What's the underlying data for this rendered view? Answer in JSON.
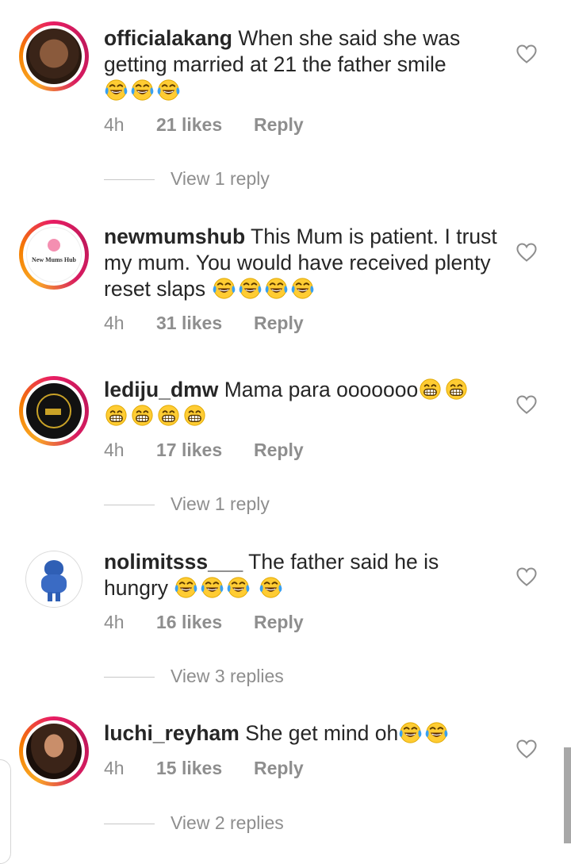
{
  "comments": [
    {
      "username": "officialakang",
      "text": "When she said she was getting married at 21 the father smile",
      "emoji_count": 3,
      "time": "4h",
      "likes": "21 likes",
      "reply": "Reply",
      "view_replies": "View 1 reply"
    },
    {
      "username": "newmumshub",
      "avatar_label": "New Mums Hub",
      "text": "This Mum is patient. I trust my mum.  You would have received plenty reset slaps",
      "emoji_count": 4,
      "time": "4h",
      "likes": "31 likes",
      "reply": "Reply"
    },
    {
      "username": "lediju_dmw",
      "text": "Mama para ooooooo",
      "emoji_count": 6,
      "time": "4h",
      "likes": "17 likes",
      "reply": "Reply",
      "view_replies": "View 1 reply"
    },
    {
      "username": "nolimitsss___",
      "text": "The father said he is hungry",
      "emoji_count": 4,
      "time": "4h",
      "likes": "16 likes",
      "reply": "Reply",
      "view_replies": "View 3 replies"
    },
    {
      "username": "luchi_reyham",
      "text": "She get mind oh",
      "emoji_count": 2,
      "time": "4h",
      "likes": "15 likes",
      "reply": "Reply",
      "view_replies": "View 2 replies"
    }
  ],
  "colors": {
    "text": "#262626",
    "secondary": "#8e8e8e",
    "story_ring": "#e91e63"
  },
  "icons": {
    "like": "heart-outline-icon",
    "laugh": "face-with-tears-of-joy-emoji",
    "grin": "grinning-face-emoji"
  }
}
